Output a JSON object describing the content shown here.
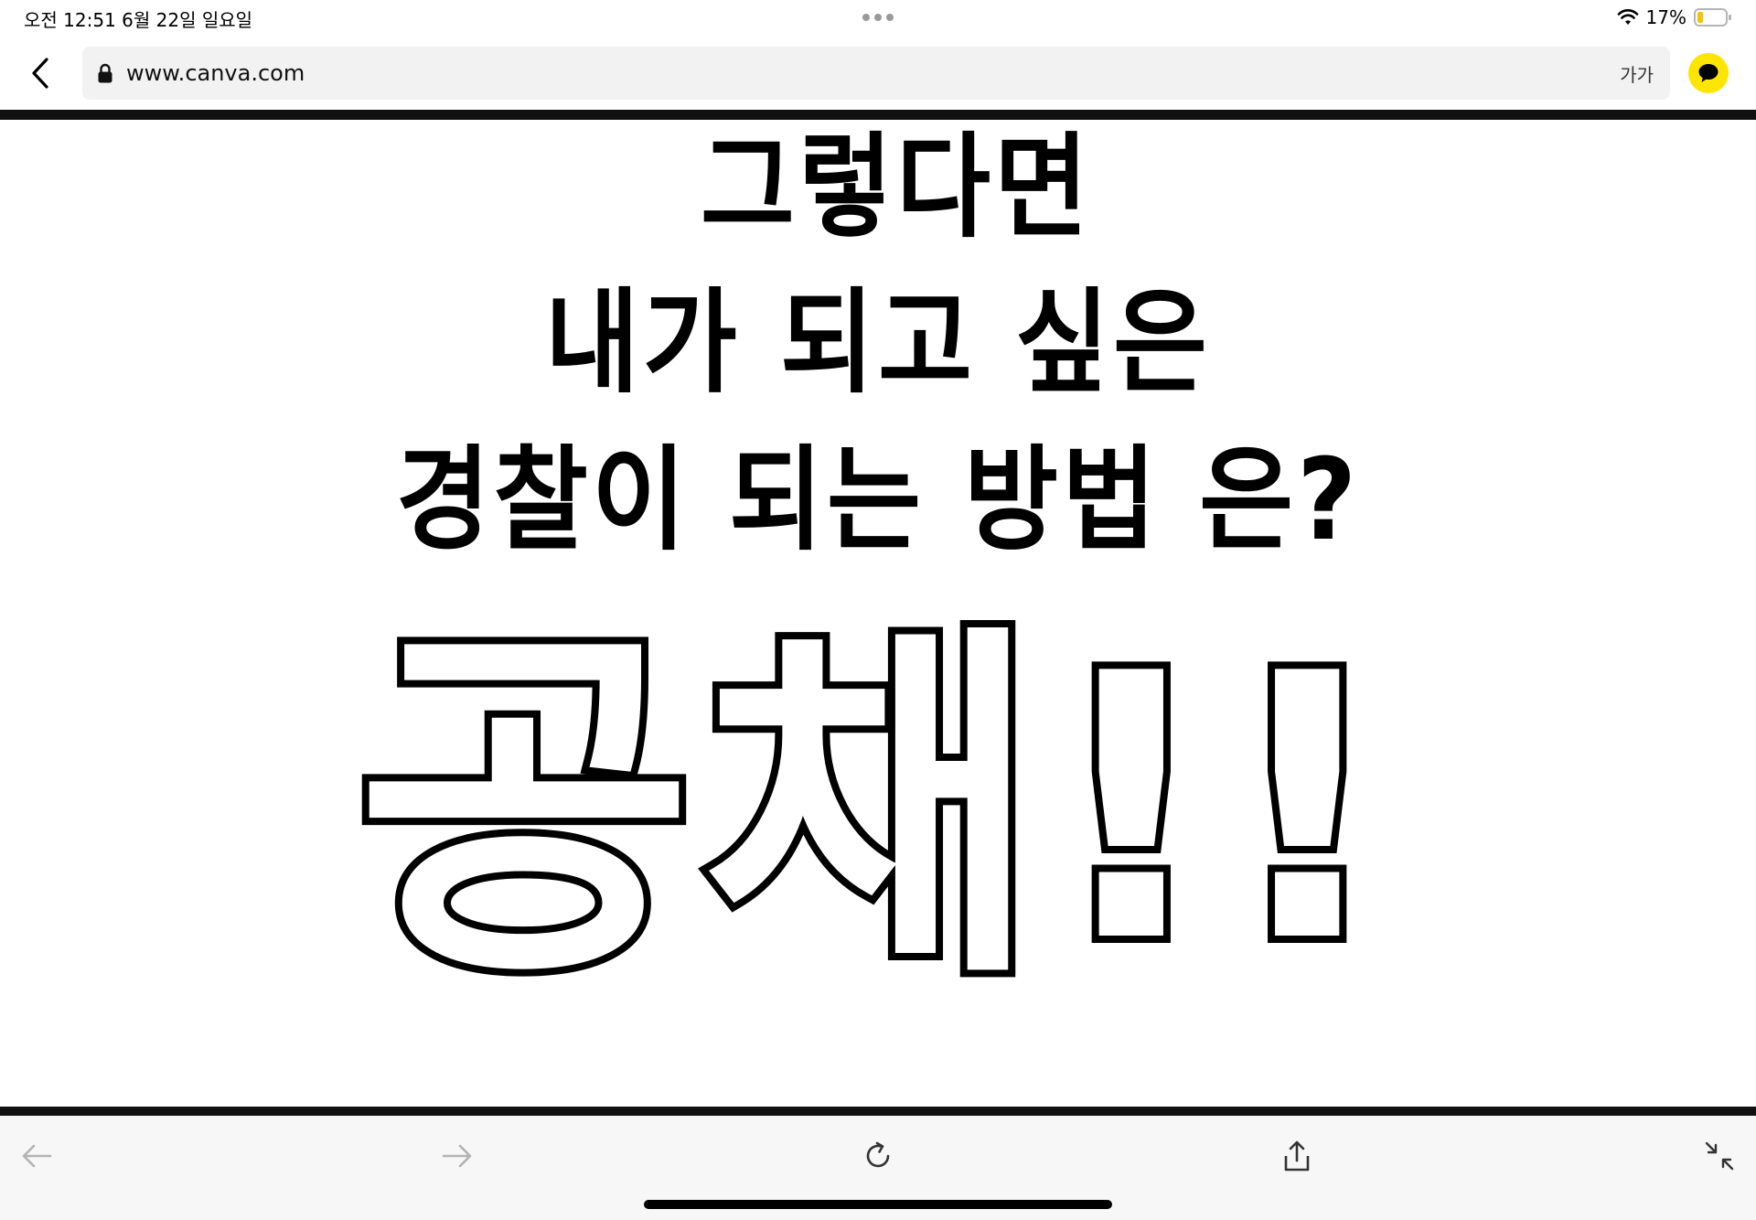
{
  "status_bar": {
    "time_date": "오전 12:51   6월 22일 일요일",
    "battery": "17%"
  },
  "address_bar": {
    "url": "www.canva.com",
    "text_size_label": "가가"
  },
  "content": {
    "line1": "그렇다면",
    "line2": "내가 되고 싶은",
    "line3": "경찰이 되는 방법 은?",
    "big_word": "공채!!"
  },
  "colors": {
    "accent_yellow": "#fee500",
    "rule": "#111111",
    "toolbar_bg": "#f7f7f7"
  },
  "icons": {
    "back": "chevron-left-icon",
    "lock": "lock-icon",
    "chat": "kakaotalk-icon",
    "toolbar": [
      "arrow-left-icon",
      "arrow-right-icon",
      "reload-icon",
      "share-icon",
      "collapse-icon"
    ]
  }
}
